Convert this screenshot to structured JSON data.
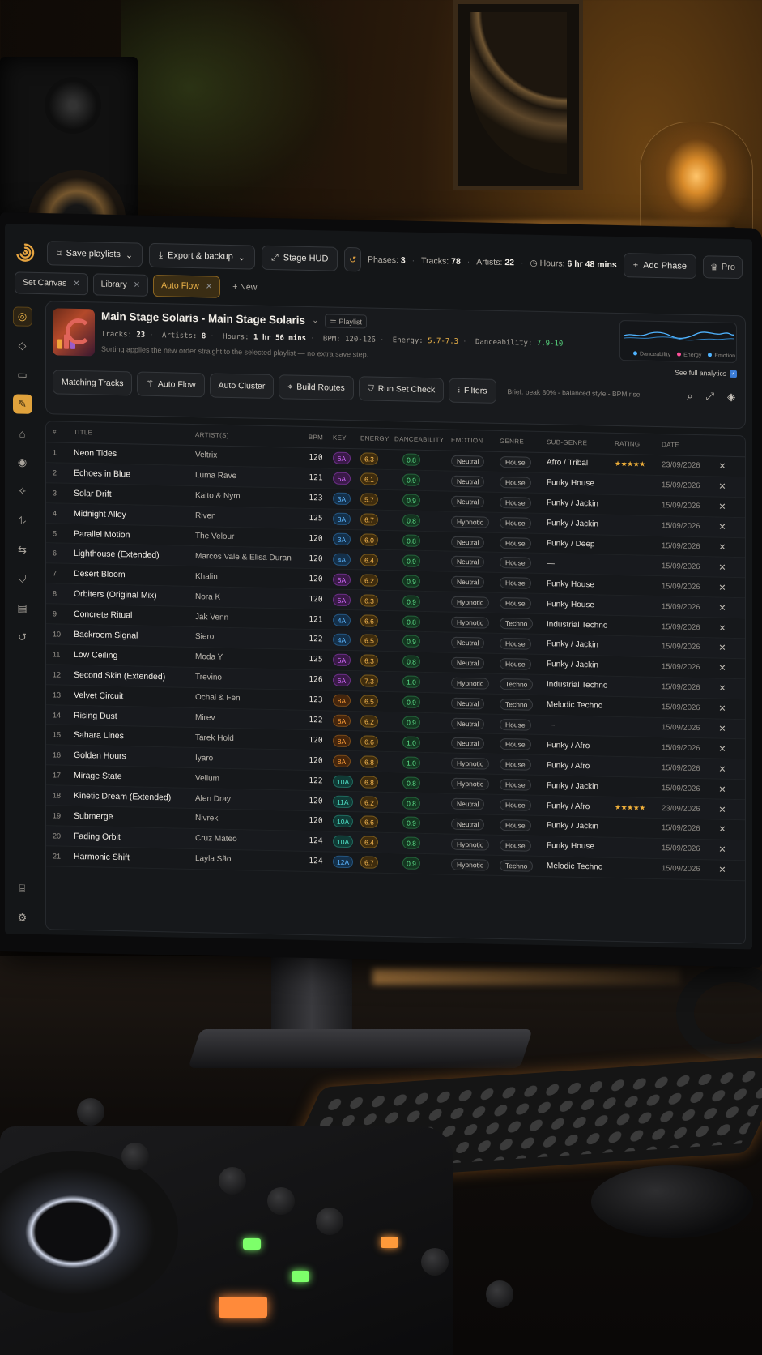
{
  "topbar": {
    "save_label": "Save playlists",
    "export_label": "Export & backup",
    "hud_label": "Stage HUD",
    "stats": {
      "phases_label": "Phases:",
      "phases": "3",
      "tracks_label": "Tracks:",
      "tracks": "78",
      "artists_label": "Artists:",
      "artists": "22",
      "hours_label": "Hours:",
      "hours": "6 hr 48 mins"
    },
    "add_phase_label": "Add Phase",
    "pro_label": "Pro"
  },
  "tabs": [
    {
      "label": "Set Canvas",
      "active": false
    },
    {
      "label": "Library",
      "active": false
    },
    {
      "label": "Auto Flow",
      "active": true
    }
  ],
  "new_tab_label": "+ New",
  "playlist": {
    "title": "Main Stage Solaris - Main Stage Solaris",
    "badge": "Playlist",
    "tracks_label": "Tracks:",
    "tracks": "23",
    "artists_label": "Artists:",
    "artists": "8",
    "hours_label": "Hours:",
    "hours": "1 hr 56 mins",
    "bpm_label": "BPM:",
    "bpm": "120-126",
    "energy_label": "Energy:",
    "energy": "5.7-7.3",
    "dance_label": "Danceability:",
    "dance": "7.9-10",
    "note": "Sorting applies the new order straight to the selected playlist — no extra save step.",
    "legend": [
      "Danceability",
      "Energy",
      "Emotion"
    ],
    "legend_colors": [
      "#4fb3ff",
      "#ff4f9a",
      "#4fb3ff"
    ],
    "see_analytics": "See full analytics"
  },
  "actions": {
    "matching": "Matching Tracks",
    "auto_flow": "Auto Flow",
    "auto_cluster": "Auto Cluster",
    "build_routes": "Build Routes",
    "run_check": "Run Set Check",
    "filters": "Filters",
    "brief": "Brief: peak 80% - balanced style - BPM rise"
  },
  "columns": [
    "#",
    "TITLE",
    "ARTIST(S)",
    "BPM",
    "KEY",
    "ENERGY",
    "DANCEABILITY",
    "EMOTION",
    "GENRE",
    "SUB-GENRE",
    "RATING",
    "DATE"
  ],
  "tracks": [
    {
      "n": "1",
      "title": "Neon Tides",
      "artist": "Veltrix",
      "bpm": "120",
      "key": "6A",
      "kc": "mag",
      "energy": "6.3",
      "dance": "0.8",
      "emotion": "Neutral",
      "genre": "House",
      "sub": "Afro / Tribal",
      "rating": "★★★★★",
      "date": "23/09/2026"
    },
    {
      "n": "2",
      "title": "Echoes in Blue",
      "artist": "Luma Rave",
      "bpm": "121",
      "key": "5A",
      "kc": "mag",
      "energy": "6.1",
      "dance": "0.9",
      "emotion": "Neutral",
      "genre": "House",
      "sub": "Funky House",
      "rating": "",
      "date": "15/09/2026"
    },
    {
      "n": "3",
      "title": "Solar Drift",
      "artist": "Kaito & Nym",
      "bpm": "123",
      "key": "3A",
      "kc": "blu",
      "energy": "5.7",
      "dance": "0.9",
      "emotion": "Neutral",
      "genre": "House",
      "sub": "Funky / Jackin",
      "rating": "",
      "date": "15/09/2026"
    },
    {
      "n": "4",
      "title": "Midnight Alloy",
      "artist": "Riven",
      "bpm": "125",
      "key": "3A",
      "kc": "blu",
      "energy": "6.7",
      "dance": "0.8",
      "emotion": "Hypnotic",
      "genre": "House",
      "sub": "Funky / Jackin",
      "rating": "",
      "date": "15/09/2026"
    },
    {
      "n": "5",
      "title": "Parallel Motion",
      "artist": "The Velour",
      "bpm": "120",
      "key": "3A",
      "kc": "blu",
      "energy": "6.0",
      "dance": "0.8",
      "emotion": "Neutral",
      "genre": "House",
      "sub": "Funky / Deep",
      "rating": "",
      "date": "15/09/2026"
    },
    {
      "n": "6",
      "title": "Lighthouse (Extended)",
      "artist": "Marcos Vale & Elisa Duran",
      "bpm": "120",
      "key": "4A",
      "kc": "blu",
      "energy": "6.4",
      "dance": "0.9",
      "emotion": "Neutral",
      "genre": "House",
      "sub": "—",
      "rating": "",
      "date": "15/09/2026"
    },
    {
      "n": "7",
      "title": "Desert Bloom",
      "artist": "Khalin",
      "bpm": "120",
      "key": "5A",
      "kc": "mag",
      "energy": "6.2",
      "dance": "0.9",
      "emotion": "Neutral",
      "genre": "House",
      "sub": "Funky House",
      "rating": "",
      "date": "15/09/2026"
    },
    {
      "n": "8",
      "title": "Orbiters (Original Mix)",
      "artist": "Nora K",
      "bpm": "120",
      "key": "5A",
      "kc": "mag",
      "energy": "6.3",
      "dance": "0.9",
      "emotion": "Hypnotic",
      "genre": "House",
      "sub": "Funky House",
      "rating": "",
      "date": "15/09/2026"
    },
    {
      "n": "9",
      "title": "Concrete Ritual",
      "artist": "Jak Venn",
      "bpm": "121",
      "key": "4A",
      "kc": "blu",
      "energy": "6.6",
      "dance": "0.8",
      "emotion": "Hypnotic",
      "genre": "Techno",
      "sub": "Industrial Techno",
      "rating": "",
      "date": "15/09/2026"
    },
    {
      "n": "10",
      "title": "Backroom Signal",
      "artist": "Siero",
      "bpm": "122",
      "key": "4A",
      "kc": "blu",
      "energy": "6.5",
      "dance": "0.9",
      "emotion": "Neutral",
      "genre": "House",
      "sub": "Funky / Jackin",
      "rating": "",
      "date": "15/09/2026"
    },
    {
      "n": "11",
      "title": "Low Ceiling",
      "artist": "Moda Y",
      "bpm": "125",
      "key": "5A",
      "kc": "mag",
      "energy": "6.3",
      "dance": "0.8",
      "emotion": "Neutral",
      "genre": "House",
      "sub": "Funky / Jackin",
      "rating": "",
      "date": "15/09/2026"
    },
    {
      "n": "12",
      "title": "Second Skin (Extended)",
      "artist": "Trevino",
      "bpm": "126",
      "key": "6A",
      "kc": "mag",
      "energy": "7.3",
      "dance": "1.0",
      "emotion": "Hypnotic",
      "genre": "Techno",
      "sub": "Industrial Techno",
      "rating": "",
      "date": "15/09/2026"
    },
    {
      "n": "13",
      "title": "Velvet Circuit",
      "artist": "Ochai & Fen",
      "bpm": "123",
      "key": "8A",
      "kc": "org",
      "energy": "6.5",
      "dance": "0.9",
      "emotion": "Neutral",
      "genre": "Techno",
      "sub": "Melodic Techno",
      "rating": "",
      "date": "15/09/2026"
    },
    {
      "n": "14",
      "title": "Rising Dust",
      "artist": "Mirev",
      "bpm": "122",
      "key": "8A",
      "kc": "org",
      "energy": "6.2",
      "dance": "0.9",
      "emotion": "Neutral",
      "genre": "House",
      "sub": "—",
      "rating": "",
      "date": "15/09/2026"
    },
    {
      "n": "15",
      "title": "Sahara Lines",
      "artist": "Tarek Hold",
      "bpm": "120",
      "key": "8A",
      "kc": "org",
      "energy": "6.6",
      "dance": "1.0",
      "emotion": "Neutral",
      "genre": "House",
      "sub": "Funky / Afro",
      "rating": "",
      "date": "15/09/2026"
    },
    {
      "n": "16",
      "title": "Golden Hours",
      "artist": "Iyaro",
      "bpm": "120",
      "key": "8A",
      "kc": "org",
      "energy": "6.8",
      "dance": "1.0",
      "emotion": "Hypnotic",
      "genre": "House",
      "sub": "Funky / Afro",
      "rating": "",
      "date": "15/09/2026"
    },
    {
      "n": "17",
      "title": "Mirage State",
      "artist": "Vellum",
      "bpm": "122",
      "key": "10A",
      "kc": "tea",
      "energy": "6.8",
      "dance": "0.8",
      "emotion": "Hypnotic",
      "genre": "House",
      "sub": "Funky / Jackin",
      "rating": "",
      "date": "15/09/2026"
    },
    {
      "n": "18",
      "title": "Kinetic Dream (Extended)",
      "artist": "Alen Dray",
      "bpm": "120",
      "key": "11A",
      "kc": "tea",
      "energy": "6.2",
      "dance": "0.8",
      "emotion": "Neutral",
      "genre": "House",
      "sub": "Funky / Afro",
      "rating": "★★★★★",
      "date": "23/09/2026"
    },
    {
      "n": "19",
      "title": "Submerge",
      "artist": "Nivrek",
      "bpm": "120",
      "key": "10A",
      "kc": "tea",
      "energy": "6.6",
      "dance": "0.9",
      "emotion": "Neutral",
      "genre": "House",
      "sub": "Funky / Jackin",
      "rating": "",
      "date": "15/09/2026"
    },
    {
      "n": "20",
      "title": "Fading Orbit",
      "artist": "Cruz Mateo",
      "bpm": "124",
      "key": "10A",
      "kc": "tea",
      "energy": "6.4",
      "dance": "0.8",
      "emotion": "Hypnotic",
      "genre": "House",
      "sub": "Funky House",
      "rating": "",
      "date": "15/09/2026"
    },
    {
      "n": "21",
      "title": "Harmonic Shift",
      "artist": "Layla São",
      "bpm": "124",
      "key": "12A",
      "kc": "blu",
      "energy": "6.7",
      "dance": "0.9",
      "emotion": "Hypnotic",
      "genre": "Techno",
      "sub": "Melodic Techno",
      "rating": "",
      "date": "15/09/2026"
    }
  ],
  "icons": {
    "logo": "spiral-logo-icon",
    "sidebar": [
      "auto-flow-icon",
      "layers-icon",
      "folder-icon",
      "wand-icon",
      "tag-icon",
      "camera-icon",
      "sparkles-icon",
      "routes-icon",
      "swap-icon",
      "shield-icon",
      "clipboard-icon",
      "history-icon",
      "drive-icon",
      "settings-icon"
    ]
  }
}
